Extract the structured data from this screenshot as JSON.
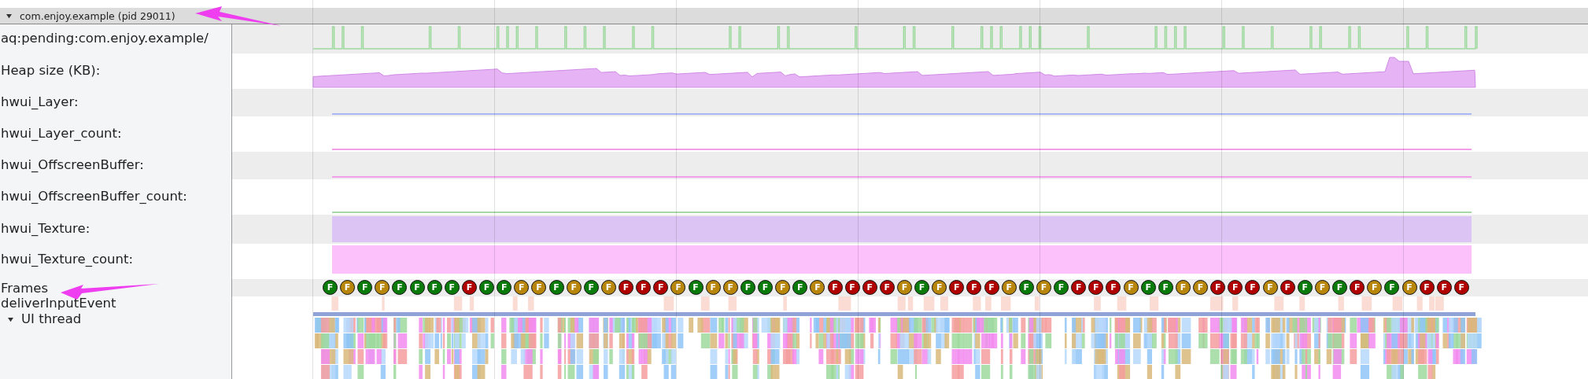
{
  "process": {
    "title": "com.enjoy.example (pid 29011)",
    "expanded": true
  },
  "counters": [
    {
      "label": "aq:pending:com.enjoy.example/",
      "kind": "pulse",
      "color": "#9dd99d"
    },
    {
      "label": "Heap size (KB):",
      "kind": "area",
      "color": "#e6b3f5"
    },
    {
      "label": "hwui_Layer:",
      "kind": "line",
      "color": "#a9b8f5"
    },
    {
      "label": "hwui_Layer_count:",
      "kind": "line",
      "color": "#f39ee8"
    },
    {
      "label": "hwui_OffscreenBuffer:",
      "kind": "line",
      "color": "#f39ee8"
    },
    {
      "label": "hwui_OffscreenBuffer_count:",
      "kind": "line",
      "color": "#a8d8a8"
    },
    {
      "label": "hwui_Texture:",
      "kind": "band",
      "color": "#dcc4f4"
    },
    {
      "label": "hwui_Texture_count:",
      "kind": "band",
      "color": "#fcc0fb"
    }
  ],
  "frames": {
    "label": "Frames",
    "items": [
      {
        "label": "F",
        "color": "#0a7a0a"
      },
      {
        "label": "F",
        "color": "#b8860b"
      },
      {
        "label": "F",
        "color": "#0a7a0a"
      },
      {
        "label": "F",
        "color": "#b8860b"
      },
      {
        "label": "F",
        "color": "#0a7a0a"
      },
      {
        "label": "F",
        "color": "#0a7a0a"
      },
      {
        "label": "F",
        "color": "#0a7a0a"
      },
      {
        "label": "F",
        "color": "#0a7a0a"
      },
      {
        "label": "F",
        "color": "#b00000"
      },
      {
        "label": "F",
        "color": "#0a7a0a"
      },
      {
        "label": "F",
        "color": "#0a7a0a"
      },
      {
        "label": "F",
        "color": "#b8860b"
      },
      {
        "label": "F",
        "color": "#b8860b"
      },
      {
        "label": "F",
        "color": "#0a7a0a"
      },
      {
        "label": "F",
        "color": "#b8860b"
      },
      {
        "label": "F",
        "color": "#0a7a0a"
      },
      {
        "label": "F",
        "color": "#b8860b"
      },
      {
        "label": "F",
        "color": "#b00000"
      },
      {
        "label": "F",
        "color": "#b00000"
      },
      {
        "label": "F",
        "color": "#b00000"
      },
      {
        "label": "F",
        "color": "#b8860b"
      },
      {
        "label": "F",
        "color": "#0a7a0a"
      },
      {
        "label": "F",
        "color": "#b8860b"
      },
      {
        "label": "F",
        "color": "#b8860b"
      },
      {
        "label": "F",
        "color": "#0a7a0a"
      },
      {
        "label": "F",
        "color": "#0a7a0a"
      },
      {
        "label": "F",
        "color": "#b8860b"
      },
      {
        "label": "F",
        "color": "#0a7a0a"
      },
      {
        "label": "F",
        "color": "#b8860b"
      },
      {
        "label": "F",
        "color": "#b00000"
      },
      {
        "label": "F",
        "color": "#b00000"
      },
      {
        "label": "F",
        "color": "#b00000"
      },
      {
        "label": "F",
        "color": "#b00000"
      },
      {
        "label": "F",
        "color": "#b8860b"
      },
      {
        "label": "F",
        "color": "#0a7a0a"
      },
      {
        "label": "F",
        "color": "#b8860b"
      },
      {
        "label": "F",
        "color": "#b00000"
      },
      {
        "label": "F",
        "color": "#b00000"
      },
      {
        "label": "F",
        "color": "#b00000"
      },
      {
        "label": "F",
        "color": "#b8860b"
      },
      {
        "label": "F",
        "color": "#0a7a0a"
      },
      {
        "label": "F",
        "color": "#b8860b"
      },
      {
        "label": "F",
        "color": "#0a7a0a"
      },
      {
        "label": "F",
        "color": "#b00000"
      },
      {
        "label": "F",
        "color": "#b00000"
      },
      {
        "label": "F",
        "color": "#b00000"
      },
      {
        "label": "F",
        "color": "#b8860b"
      },
      {
        "label": "F",
        "color": "#0a7a0a"
      },
      {
        "label": "F",
        "color": "#0a7a0a"
      },
      {
        "label": "F",
        "color": "#b8860b"
      },
      {
        "label": "F",
        "color": "#b8860b"
      },
      {
        "label": "F",
        "color": "#b00000"
      },
      {
        "label": "F",
        "color": "#b00000"
      },
      {
        "label": "F",
        "color": "#b00000"
      },
      {
        "label": "F",
        "color": "#b8860b"
      },
      {
        "label": "F",
        "color": "#b00000"
      },
      {
        "label": "F",
        "color": "#0a7a0a"
      },
      {
        "label": "F",
        "color": "#b8860b"
      },
      {
        "label": "F",
        "color": "#0a7a0a"
      },
      {
        "label": "F",
        "color": "#b00000"
      },
      {
        "label": "F",
        "color": "#b8860b"
      },
      {
        "label": "F",
        "color": "#0a7a0a"
      },
      {
        "label": "F",
        "color": "#b8860b"
      },
      {
        "label": "F",
        "color": "#b00000"
      },
      {
        "label": "F",
        "color": "#b00000"
      },
      {
        "label": "F",
        "color": "#b00000"
      }
    ]
  },
  "input_events": {
    "label": "deliverInputEvent"
  },
  "ui_thread": {
    "label": "UI thread",
    "expanded": true
  }
}
